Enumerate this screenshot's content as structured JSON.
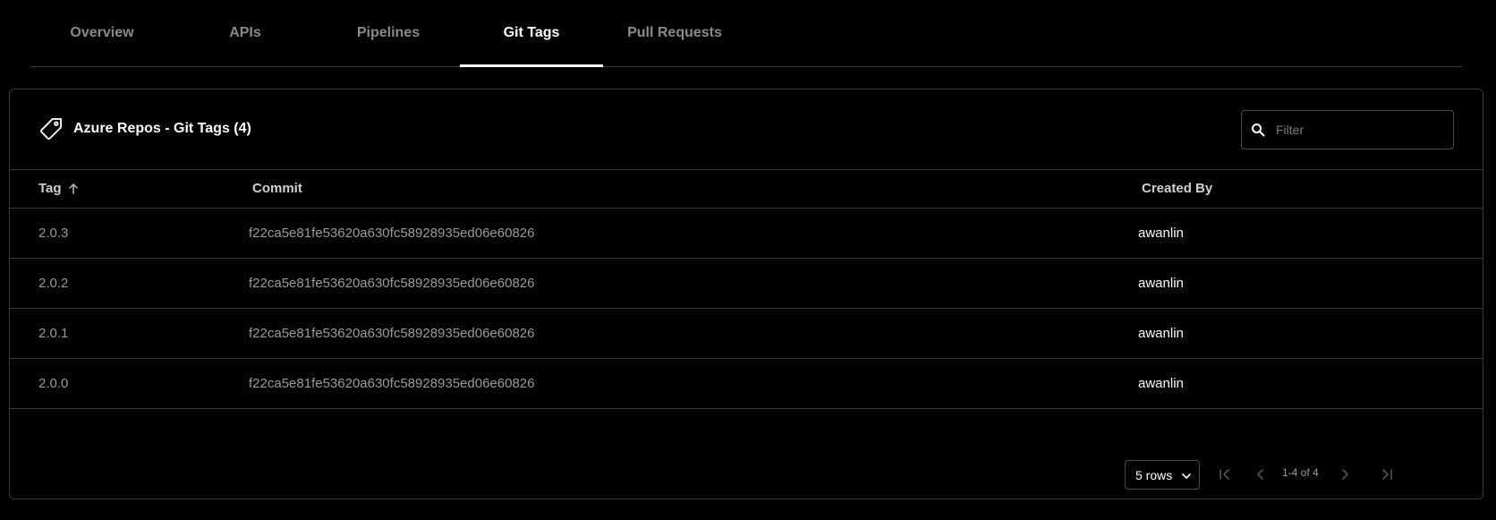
{
  "tabs": [
    {
      "label": "Overview",
      "active": false
    },
    {
      "label": "APIs",
      "active": false
    },
    {
      "label": "Pipelines",
      "active": false
    },
    {
      "label": "Git Tags",
      "active": true
    },
    {
      "label": "Pull Requests",
      "active": false
    }
  ],
  "card": {
    "title": "Azure Repos - Git Tags (4)",
    "icon": "tag-icon",
    "filter_placeholder": "Filter"
  },
  "table": {
    "columns": {
      "tag": "Tag",
      "commit": "Commit",
      "created_by": "Created By"
    },
    "sort": {
      "column": "Tag",
      "direction": "ascending"
    },
    "rows": [
      {
        "tag": "2.0.3",
        "commit": "f22ca5e81fe53620a630fc58928935ed06e60826",
        "created_by": "awanlin"
      },
      {
        "tag": "2.0.2",
        "commit": "f22ca5e81fe53620a630fc58928935ed06e60826",
        "created_by": "awanlin"
      },
      {
        "tag": "2.0.1",
        "commit": "f22ca5e81fe53620a630fc58928935ed06e60826",
        "created_by": "awanlin"
      },
      {
        "tag": "2.0.0",
        "commit": "f22ca5e81fe53620a630fc58928935ed06e60826",
        "created_by": "awanlin"
      }
    ]
  },
  "pagination": {
    "rows_per_page": "5 rows",
    "range": "1-4 of 4"
  },
  "colors": {
    "background": "#000000",
    "border": "#3a3a3a",
    "muted_text": "#9a9a9a"
  }
}
